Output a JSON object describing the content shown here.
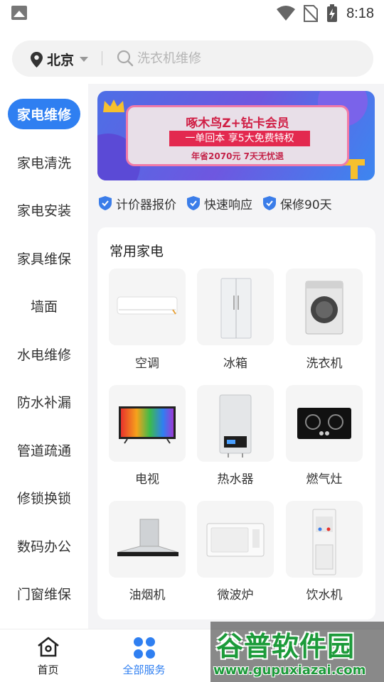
{
  "status_bar": {
    "time": "8:18",
    "icons": [
      "image-icon",
      "wifi-icon",
      "no-sim-icon",
      "battery-charging-icon"
    ]
  },
  "search": {
    "city": "北京",
    "placeholder": "洗衣机维修"
  },
  "sidebar": {
    "items": [
      {
        "label": "家电维修",
        "active": true
      },
      {
        "label": "家电清洗"
      },
      {
        "label": "家电安装"
      },
      {
        "label": "家具维保"
      },
      {
        "label": "墙面"
      },
      {
        "label": "水电维修"
      },
      {
        "label": "防水补漏"
      },
      {
        "label": "管道疏通"
      },
      {
        "label": "修锁换锁"
      },
      {
        "label": "数码办公"
      },
      {
        "label": "门窗维保"
      }
    ]
  },
  "banner": {
    "title": "啄木鸟Z+钻卡会员",
    "ribbon": "一单回本 享5大免费特权",
    "subtitle": "年省2070元 7天无忧退"
  },
  "guarantees": [
    "计价器报价",
    "快速响应",
    "保修90天"
  ],
  "section": {
    "title": "常用家电",
    "items": [
      {
        "label": "空调",
        "icon": "air-conditioner-icon"
      },
      {
        "label": "冰箱",
        "icon": "refrigerator-icon"
      },
      {
        "label": "洗衣机",
        "icon": "washing-machine-icon"
      },
      {
        "label": "电视",
        "icon": "tv-icon"
      },
      {
        "label": "热水器",
        "icon": "water-heater-icon"
      },
      {
        "label": "燃气灶",
        "icon": "gas-stove-icon"
      },
      {
        "label": "油烟机",
        "icon": "range-hood-icon"
      },
      {
        "label": "微波炉",
        "icon": "microwave-icon"
      },
      {
        "label": "饮水机",
        "icon": "water-dispenser-icon"
      }
    ]
  },
  "bottom_nav": {
    "items": [
      {
        "label": "首页",
        "icon": "home-icon"
      },
      {
        "label": "全部服务",
        "icon": "all-services-icon",
        "active": true
      }
    ]
  },
  "watermark": {
    "title": "谷普软件园",
    "url": "www.gupuxiazai.com"
  },
  "colors": {
    "accent": "#2f7ff1",
    "banner_red": "#e3294f"
  }
}
